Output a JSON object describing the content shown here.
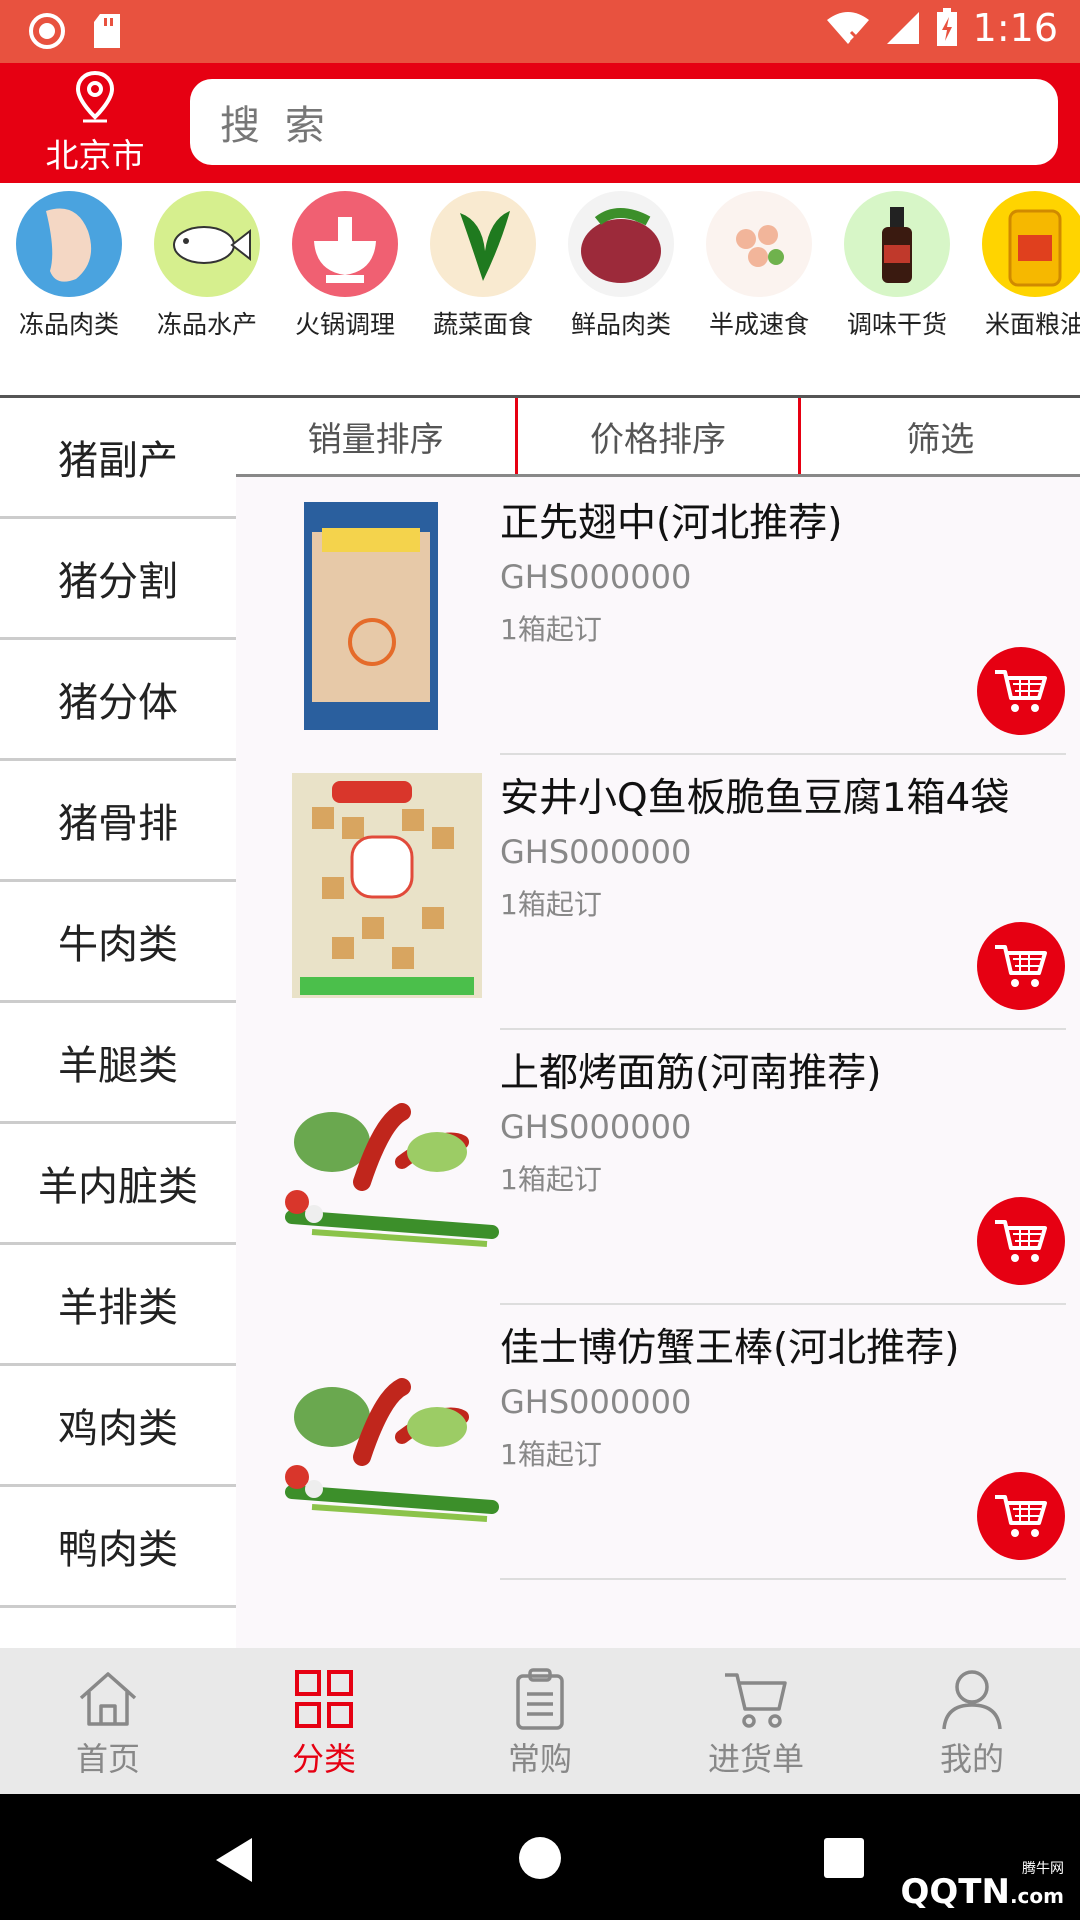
{
  "status": {
    "time": "1:16"
  },
  "header": {
    "city": "北京市",
    "search_placeholder": "搜 索"
  },
  "categories": [
    {
      "label": "冻品肉类",
      "color": "#4aa3df"
    },
    {
      "label": "冻品水产",
      "color": "#d6ef8e"
    },
    {
      "label": "火锅调理",
      "color": "#f06072"
    },
    {
      "label": "蔬菜面食",
      "color": "#f9ead0"
    },
    {
      "label": "鲜品肉类",
      "color": "#f3f3f3"
    },
    {
      "label": "半成速食",
      "color": "#fbf3ef"
    },
    {
      "label": "调味干货",
      "color": "#d7f6c7"
    },
    {
      "label": "米面粮油",
      "color": "#ffd400"
    }
  ],
  "sidebar": {
    "items": [
      "猪副产",
      "猪分割",
      "猪分体",
      "猪骨排",
      "牛肉类",
      "羊腿类",
      "羊内脏类",
      "羊排类",
      "鸡肉类",
      "鸭肉类"
    ]
  },
  "sort": {
    "sales": "销量排序",
    "price": "价格排序",
    "filter": "筛选"
  },
  "products": [
    {
      "name": "正先翅中(河北推荐)",
      "code": "GHS000000",
      "moq": "1箱起订"
    },
    {
      "name": "安井小Q鱼板脆鱼豆腐1箱4袋",
      "code": "GHS000000",
      "moq": "1箱起订"
    },
    {
      "name": "上都烤面筋(河南推荐)",
      "code": "GHS000000",
      "moq": "1箱起订"
    },
    {
      "name": "佳士博仿蟹王棒(河北推荐)",
      "code": "GHS000000",
      "moq": "1箱起订"
    }
  ],
  "tabbar": {
    "home": "首页",
    "category": "分类",
    "frequent": "常购",
    "cart": "进货单",
    "mine": "我的"
  },
  "watermark": {
    "brand": "QQTN",
    "suffix": ".com",
    "site": "腾牛网"
  },
  "colors": {
    "brand": "#e60012",
    "status_bar": "#e8523f"
  }
}
